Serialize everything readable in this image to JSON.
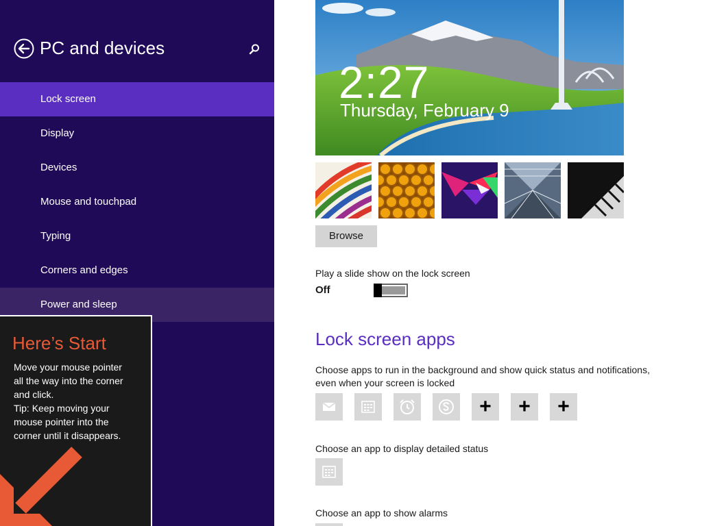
{
  "sidebar": {
    "title": "PC and devices",
    "back_icon": "back-arrow-icon",
    "search_icon": "search-icon",
    "items": [
      {
        "label": "Lock screen",
        "state": "selected"
      },
      {
        "label": "Display",
        "state": ""
      },
      {
        "label": "Devices",
        "state": ""
      },
      {
        "label": "Mouse and touchpad",
        "state": ""
      },
      {
        "label": "Typing",
        "state": ""
      },
      {
        "label": "Corners and edges",
        "state": ""
      },
      {
        "label": "Power and sleep",
        "state": "hover"
      }
    ]
  },
  "start_tip": {
    "title": "Here’s Start",
    "lines": [
      "Move your mouse pointer",
      "all the way into the corner",
      "and click.",
      "Tip: Keep moving your",
      "mouse pointer into the",
      "corner until it disappears."
    ],
    "arrow_icon": "arrow-down-left-icon"
  },
  "preview": {
    "time": "2:27",
    "date": "Thursday, February 9"
  },
  "thumbnails": [
    {
      "name": "thumb-colored-stripes"
    },
    {
      "name": "thumb-honeycomb"
    },
    {
      "name": "thumb-geometric"
    },
    {
      "name": "thumb-tunnel"
    },
    {
      "name": "thumb-piano"
    }
  ],
  "browse_label": "Browse",
  "slideshow": {
    "label": "Play a slide show on the lock screen",
    "state": "Off"
  },
  "lock_apps": {
    "title": "Lock screen apps",
    "description_line1": "Choose apps to run in the background and show quick status and notifications,",
    "description_line2": "even when your screen is locked",
    "slots": [
      {
        "icon": "mail-icon",
        "text": ""
      },
      {
        "icon": "calendar-icon",
        "text": ""
      },
      {
        "icon": "alarm-clock-icon",
        "text": ""
      },
      {
        "icon": "skype-icon",
        "text": ""
      },
      {
        "icon": "plus-icon",
        "text": "+"
      },
      {
        "icon": "plus-icon",
        "text": "+"
      },
      {
        "icon": "plus-icon",
        "text": "+"
      }
    ],
    "detailed_label": "Choose an app to display detailed status",
    "detailed_icon": "calendar-icon",
    "alarms_label": "Choose an app to show alarms"
  },
  "colors": {
    "sidebar_bg": "#1f0a58",
    "selected_bg": "#5a2ec0",
    "accent": "#5a2ec0",
    "tip_title": "#e85a36"
  }
}
